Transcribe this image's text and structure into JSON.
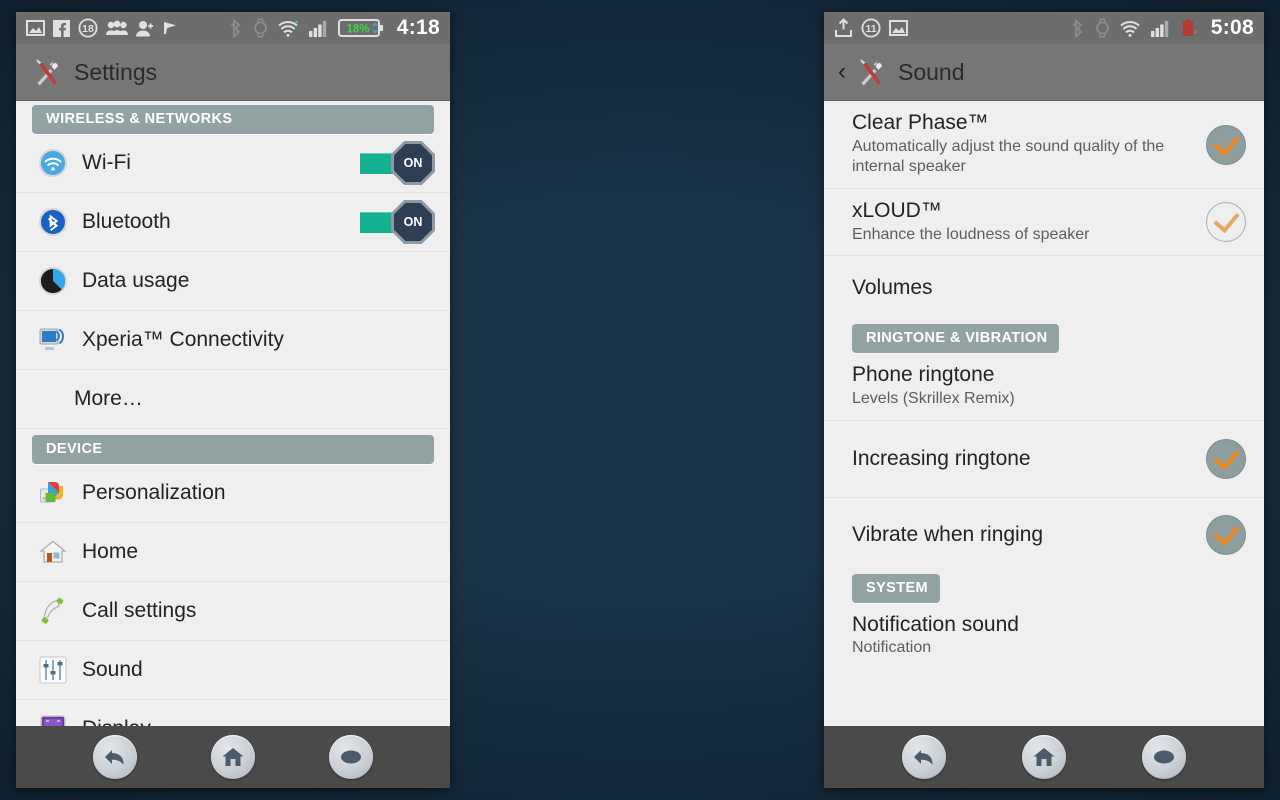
{
  "wallpaper": {
    "name": "denim-blue-fabric",
    "color": "#2d6a88"
  },
  "theme": {
    "accent_orange": "#f2871e",
    "toggle_on_green": "#15b092",
    "section_header_bg": "#93a3a3",
    "actionbar_bg": "#767676",
    "statusbar_bg": "#6d6d6d",
    "list_bg": "#efefef",
    "navbar_bg": "#4a4a4a"
  },
  "left_phone": {
    "statusbar": {
      "left_icons": [
        "image-icon",
        "facebook-icon",
        "notification-count-badge",
        "people-icon",
        "add-contact-icon",
        "flag-icon"
      ],
      "notification_count": "18",
      "right_icons": [
        "bluetooth-icon",
        "smartwatch-icon",
        "wifi-icon",
        "signal-icon",
        "battery-icon"
      ],
      "battery_level": "18%",
      "clock": "4:18"
    },
    "actionbar": {
      "title": "Settings",
      "icon": "tools-icon"
    },
    "sections": [
      {
        "header": "WIRELESS & NETWORKS",
        "header_style": "full",
        "rows": [
          {
            "label": "Wi-Fi",
            "icon": "wifi-icon",
            "control": "toggle",
            "toggle_label": "ON",
            "toggle_state": "on"
          },
          {
            "label": "Bluetooth",
            "icon": "bluetooth-icon",
            "control": "toggle",
            "toggle_label": "ON",
            "toggle_state": "on"
          },
          {
            "label": "Data usage",
            "icon": "data-usage-icon",
            "control": "none"
          },
          {
            "label": "Xperia™ Connectivity",
            "icon": "xperia-connectivity-icon",
            "control": "none"
          },
          {
            "label": "More…",
            "icon": "none",
            "control": "none"
          }
        ]
      },
      {
        "header": "DEVICE",
        "header_style": "full",
        "rows": [
          {
            "label": "Personalization",
            "icon": "personalization-icon",
            "control": "none"
          },
          {
            "label": "Home",
            "icon": "home-icon",
            "control": "none"
          },
          {
            "label": "Call settings",
            "icon": "phone-icon",
            "control": "none"
          },
          {
            "label": "Sound",
            "icon": "sound-sliders-icon",
            "control": "none"
          },
          {
            "label": "Display",
            "icon": "display-icon",
            "control": "none"
          }
        ]
      }
    ],
    "navbar": {
      "buttons": [
        "back-icon",
        "home-icon",
        "recent-apps-icon"
      ]
    }
  },
  "right_phone": {
    "statusbar": {
      "left_icons": [
        "upload-icon",
        "notification-count-badge",
        "image-icon"
      ],
      "notification_count": "11",
      "right_icons": [
        "bluetooth-icon",
        "smartwatch-icon",
        "wifi-icon",
        "signal-icon",
        "battery-low-icon"
      ],
      "clock": "5:08"
    },
    "actionbar": {
      "title": "Sound",
      "icon": "tools-icon",
      "back": "back-chevron-icon"
    },
    "rows": [
      {
        "title": "Clear Phase™",
        "subtitle": "Automatically adjust the sound quality of the internal speaker",
        "control": "check",
        "checked": "on"
      },
      {
        "title": "xLOUD™",
        "subtitle": "Enhance the loudness of speaker",
        "control": "check",
        "checked": "off"
      },
      {
        "title": "Volumes",
        "subtitle": "",
        "control": "none"
      }
    ],
    "section_ringtone": {
      "header": "RINGTONE & VIBRATION",
      "rows": [
        {
          "title": "Phone ringtone",
          "subtitle": "Levels (Skrillex Remix)",
          "control": "none"
        },
        {
          "title": "Increasing ringtone",
          "subtitle": "",
          "control": "check",
          "checked": "on"
        },
        {
          "title": "Vibrate when ringing",
          "subtitle": "",
          "control": "check",
          "checked": "on"
        }
      ]
    },
    "section_system": {
      "header": "SYSTEM",
      "rows": [
        {
          "title": "Notification sound",
          "subtitle": "Notification",
          "control": "none"
        }
      ]
    },
    "navbar": {
      "buttons": [
        "back-icon",
        "home-icon",
        "recent-apps-icon"
      ]
    }
  }
}
